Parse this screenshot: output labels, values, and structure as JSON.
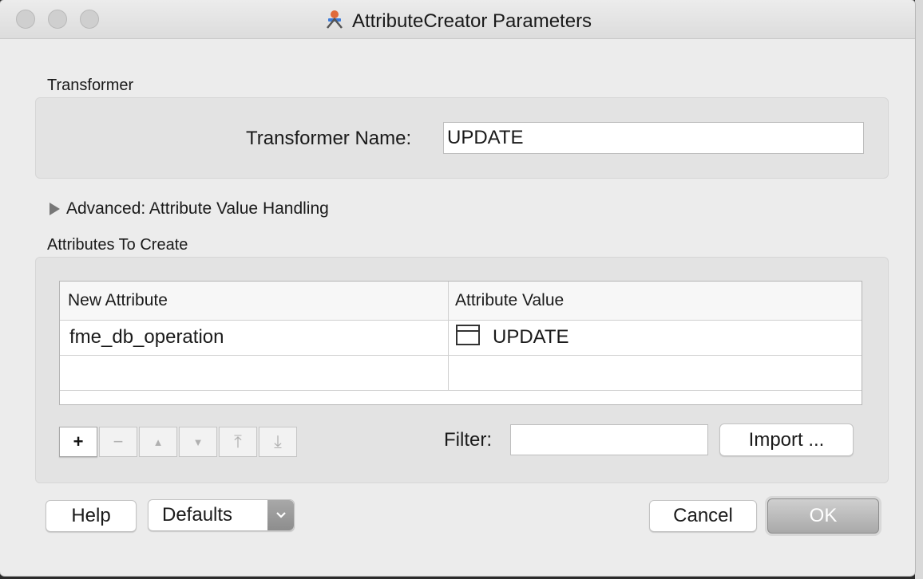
{
  "window": {
    "title": "AttributeCreator Parameters",
    "app_icon": "transformer-icon"
  },
  "transformer_section": {
    "label": "Transformer",
    "name_label": "Transformer Name:",
    "name_value": "UPDATE"
  },
  "advanced": {
    "label": "Advanced: Attribute Value Handling",
    "expanded": false
  },
  "attributes_section": {
    "label": "Attributes To Create",
    "columns": [
      "New Attribute",
      "Attribute Value"
    ],
    "rows": [
      {
        "attribute": "fme_db_operation",
        "value": "UPDATE",
        "value_icon": "text-value-icon"
      },
      {
        "attribute": "",
        "value": ""
      }
    ]
  },
  "toolbar": {
    "add": "+",
    "remove": "−",
    "move_up": "▲",
    "move_down": "▼",
    "move_top": "⤒",
    "move_bottom": "⤓"
  },
  "filter": {
    "label": "Filter:",
    "value": ""
  },
  "import_button": "Import ...",
  "footer": {
    "help": "Help",
    "defaults": "Defaults",
    "cancel": "Cancel",
    "ok": "OK"
  }
}
